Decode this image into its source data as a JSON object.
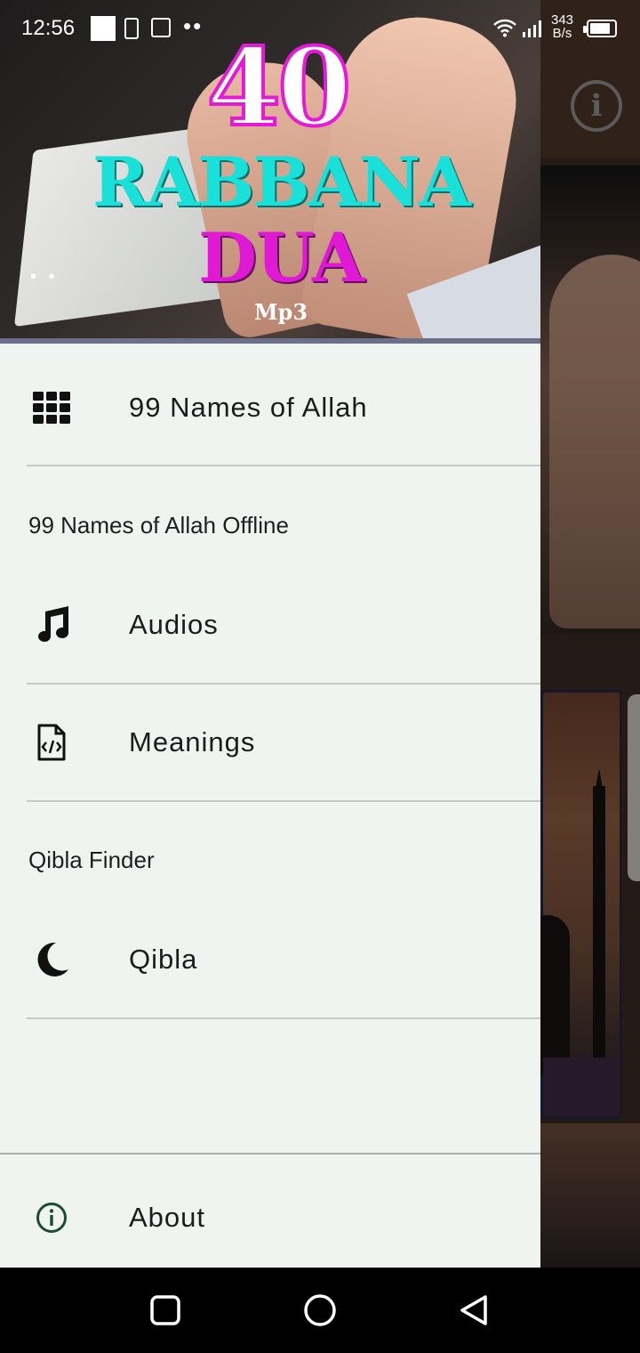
{
  "status_bar": {
    "time": "12:56",
    "speed_value": "343",
    "speed_unit": "B/s"
  },
  "header": {
    "title_number": "40",
    "title_line1": "RABBANA",
    "title_line2": "DUA",
    "title_format": "Mp3",
    "colors": {
      "pink": "#e41ad8",
      "cyan": "#19e0d8"
    }
  },
  "drawer": {
    "items": [
      {
        "label": "99 Names of Allah",
        "icon": "grid-icon"
      }
    ],
    "sections": [
      {
        "title": "99 Names of Allah Offline",
        "items": [
          {
            "label": "Audios",
            "icon": "music-note-icon"
          },
          {
            "label": "Meanings",
            "icon": "code-file-icon"
          }
        ]
      },
      {
        "title": "Qibla Finder",
        "items": [
          {
            "label": "Qibla",
            "icon": "crescent-moon-icon"
          }
        ]
      }
    ],
    "footer_item": {
      "label": "About",
      "icon": "info-icon"
    }
  },
  "background_app": {
    "toolbar_icon": "info-icon",
    "toolbar_icon_glyph": "i"
  },
  "navigation_bar": {
    "buttons": [
      "recents-button",
      "home-button",
      "back-button"
    ]
  }
}
